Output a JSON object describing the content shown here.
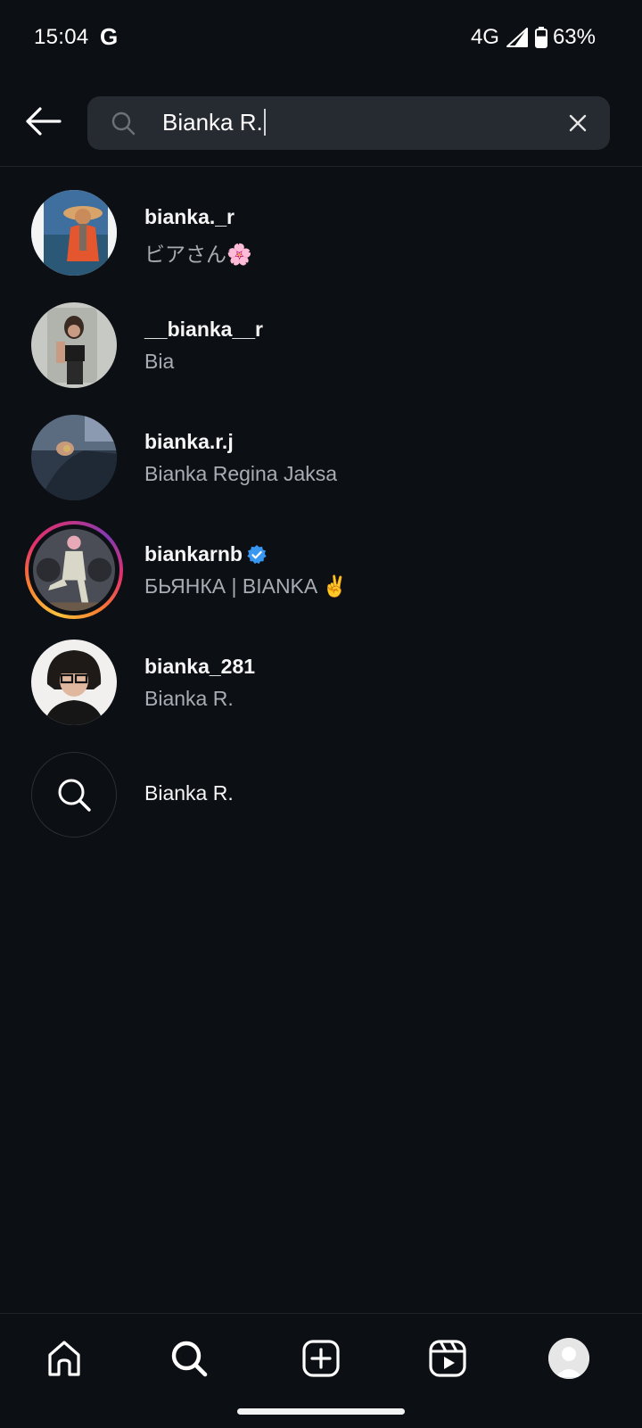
{
  "status_bar": {
    "time": "15:04",
    "g_glyph": "G",
    "network": "4G",
    "battery_percent": "63%",
    "battery_level": 0.63
  },
  "search": {
    "query": "Bianka R.",
    "placeholder": "Search"
  },
  "results": [
    {
      "username": "bianka._r",
      "full_name": "ビアさん🌸",
      "verified": false,
      "has_story": false
    },
    {
      "username": "__bianka__r",
      "full_name": "Bia",
      "verified": false,
      "has_story": false
    },
    {
      "username": "bianka.r.j",
      "full_name": "Bianka Regina Jaksa",
      "verified": false,
      "has_story": false
    },
    {
      "username": "biankarnb",
      "full_name": "БЬЯНКА | BIANKA ✌️",
      "verified": true,
      "has_story": true
    },
    {
      "username": "bianka_281",
      "full_name": "Bianka R.",
      "verified": false,
      "has_story": false
    }
  ],
  "suggestion": {
    "text": "Bianka R."
  },
  "bottom_nav": {
    "items": [
      "home-icon",
      "search-icon",
      "create-icon",
      "reels-icon",
      "profile-avatar"
    ],
    "active": "search-icon"
  },
  "colors": {
    "background": "#0c0f14",
    "search_box": "#262a31",
    "secondary_text": "#a8acb3",
    "verified_blue": "#3897f0"
  }
}
